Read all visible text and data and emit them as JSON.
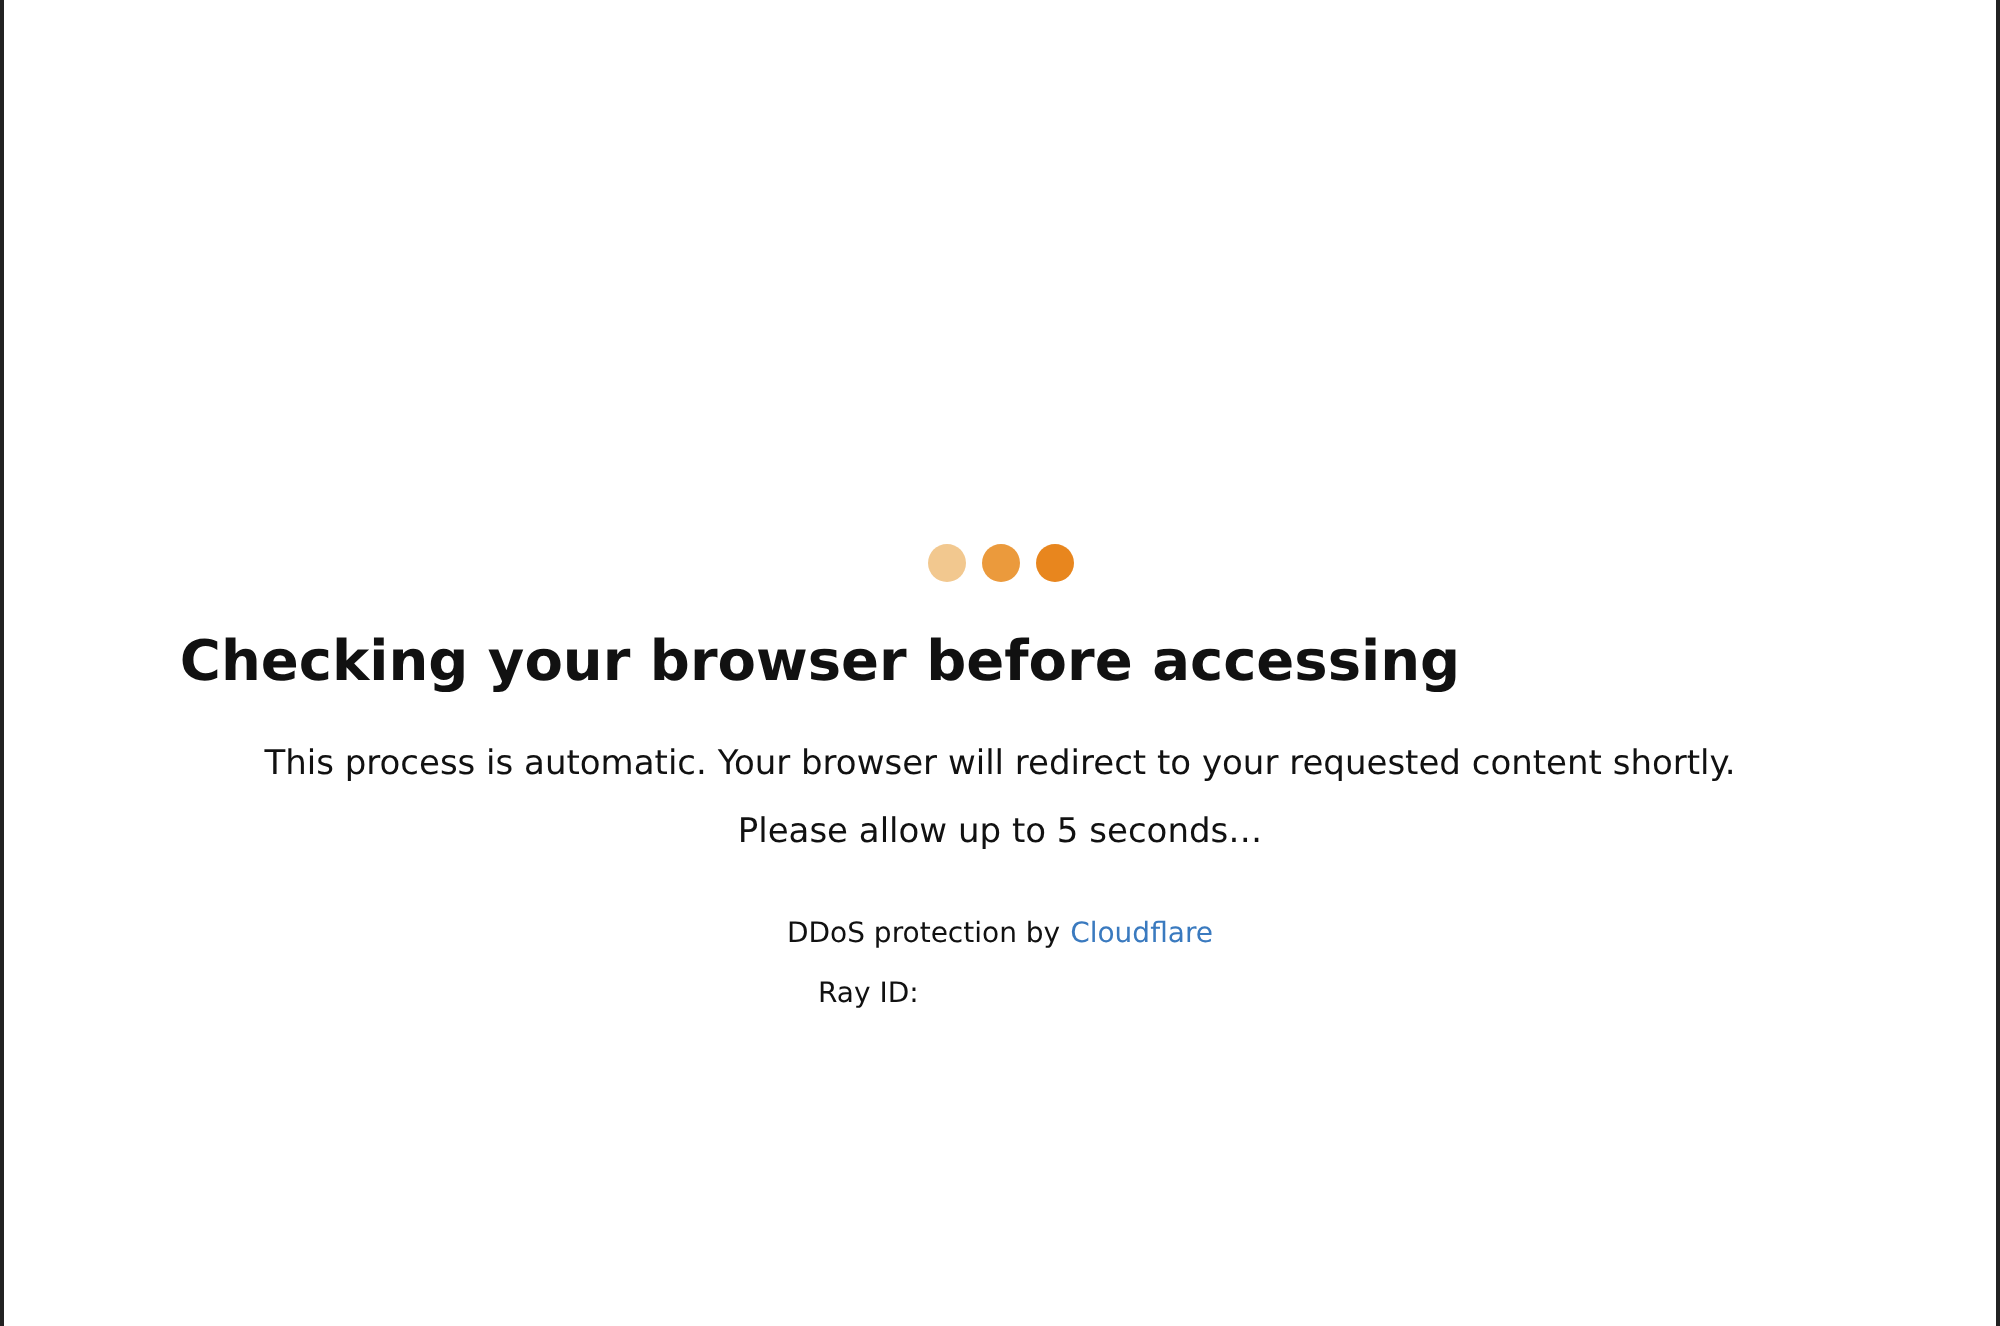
{
  "loader": {
    "dots": [
      {
        "color": "#f2c88f"
      },
      {
        "color": "#eb9a3c"
      },
      {
        "color": "#e8861e"
      }
    ]
  },
  "heading": "Checking your browser before accessing",
  "messages": [
    "This process is automatic. Your browser will redirect to your requested content shortly.",
    "Please allow up to 5 seconds…"
  ],
  "footer": {
    "protection_text": "DDoS protection by",
    "link": "Cloudflare",
    "ray_label": "Ray ID:"
  }
}
